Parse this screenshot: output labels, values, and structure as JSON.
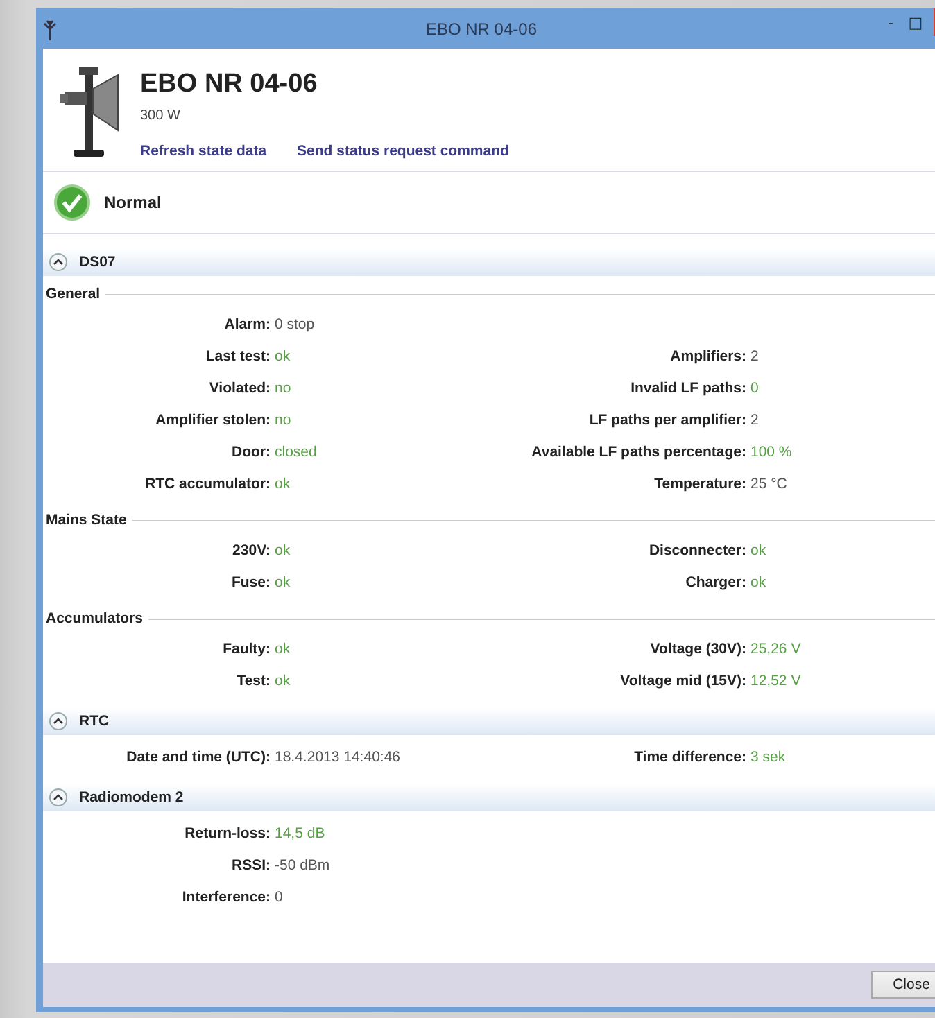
{
  "window": {
    "title": "EBO NR 04-06",
    "controls": [
      "-",
      "□"
    ]
  },
  "header": {
    "name": "EBO NR 04-06",
    "power": "300 W",
    "links": [
      "Refresh state data",
      "Send status request command"
    ]
  },
  "status": {
    "kind": "ok",
    "label": "Normal"
  },
  "sections": [
    {
      "title": "DS07",
      "expanded": true,
      "groups": [
        {
          "title": "General",
          "rows": [
            {
              "left": {
                "label": "Alarm:",
                "value": "0 stop",
                "highlight": false
              }
            },
            {
              "left": {
                "label": "Last test:",
                "value": "ok",
                "highlight": true
              },
              "right": {
                "label": "Amplifiers:",
                "value": "2",
                "highlight": false
              }
            },
            {
              "left": {
                "label": "Violated:",
                "value": "no",
                "highlight": true
              },
              "right": {
                "label": "Invalid LF paths:",
                "value": "0",
                "highlight": true
              }
            },
            {
              "left": {
                "label": "Amplifier stolen:",
                "value": "no",
                "highlight": true
              },
              "right": {
                "label": "LF paths per amplifier:",
                "value": "2",
                "highlight": false
              }
            },
            {
              "left": {
                "label": "Door:",
                "value": "closed",
                "highlight": true
              },
              "right": {
                "label": "Available LF paths percentage:",
                "value": "100 %",
                "highlight": true
              }
            },
            {
              "left": {
                "label": "RTC accumulator:",
                "value": "ok",
                "highlight": true
              },
              "right": {
                "label": "Temperature:",
                "value": "25 °C",
                "highlight": false
              }
            }
          ]
        },
        {
          "title": "Mains State",
          "rows": [
            {
              "left": {
                "label": "230V:",
                "value": "ok",
                "highlight": true
              },
              "right": {
                "label": "Disconnecter:",
                "value": "ok",
                "highlight": true
              }
            },
            {
              "left": {
                "label": "Fuse:",
                "value": "ok",
                "highlight": true
              },
              "right": {
                "label": "Charger:",
                "value": "ok",
                "highlight": true
              }
            }
          ]
        },
        {
          "title": "Accumulators",
          "rows": [
            {
              "left": {
                "label": "Faulty:",
                "value": "ok",
                "highlight": true
              },
              "right": {
                "label": "Voltage (30V):",
                "value": "25,26 V",
                "highlight": true
              }
            },
            {
              "left": {
                "label": "Test:",
                "value": "ok",
                "highlight": true
              },
              "right": {
                "label": "Voltage mid (15V):",
                "value": "12,52 V",
                "highlight": true
              }
            }
          ]
        }
      ]
    },
    {
      "title": "RTC",
      "expanded": true,
      "groups": [
        {
          "rows": [
            {
              "left": {
                "label": "Date and time (UTC):",
                "value": "18.4.2013 14:40:46",
                "highlight": false
              },
              "right": {
                "label": "Time difference:",
                "value": "3 sek",
                "highlight": true
              }
            }
          ]
        }
      ]
    },
    {
      "title": "Radiomodem 2",
      "expanded": true,
      "groups": [
        {
          "rows": [
            {
              "left": {
                "label": "Return-loss:",
                "value": "14,5 dB",
                "highlight": true
              }
            },
            {
              "left": {
                "label": "RSSI:",
                "value": "-50 dBm",
                "highlight": false
              }
            },
            {
              "left": {
                "label": "Interference:",
                "value": "0",
                "highlight": false
              }
            }
          ]
        }
      ]
    }
  ],
  "footer": {
    "buttons": [
      "Close"
    ]
  }
}
